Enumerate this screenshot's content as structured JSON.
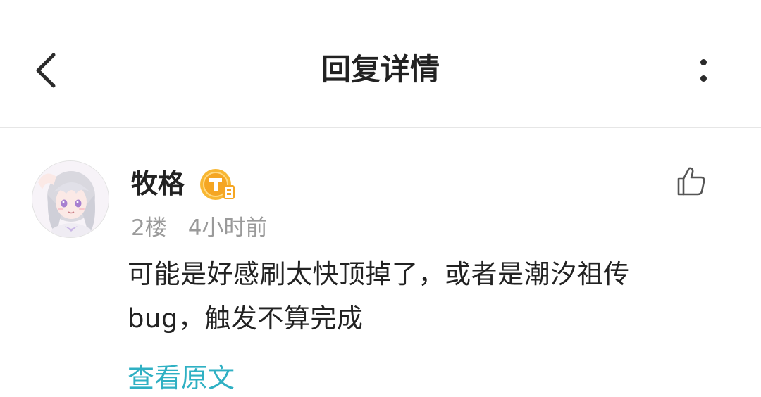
{
  "header": {
    "title": "回复详情",
    "back_icon": "chevron-left-icon",
    "more_icon": "more-vertical-icon"
  },
  "reply": {
    "username": "牧格",
    "badge_icon": "user-level-badge-icon",
    "floor": "2楼",
    "time": "4小时前",
    "like_icon": "thumbs-up-icon",
    "content": "可能是好感刷太快顶掉了，或者是潮汐祖传bug，触发不算完成",
    "view_original_label": "查看原文"
  },
  "colors": {
    "accent": "#2fb0c3",
    "badge": "#f5a623",
    "meta_text": "#9a9a9a",
    "text": "#222222"
  }
}
